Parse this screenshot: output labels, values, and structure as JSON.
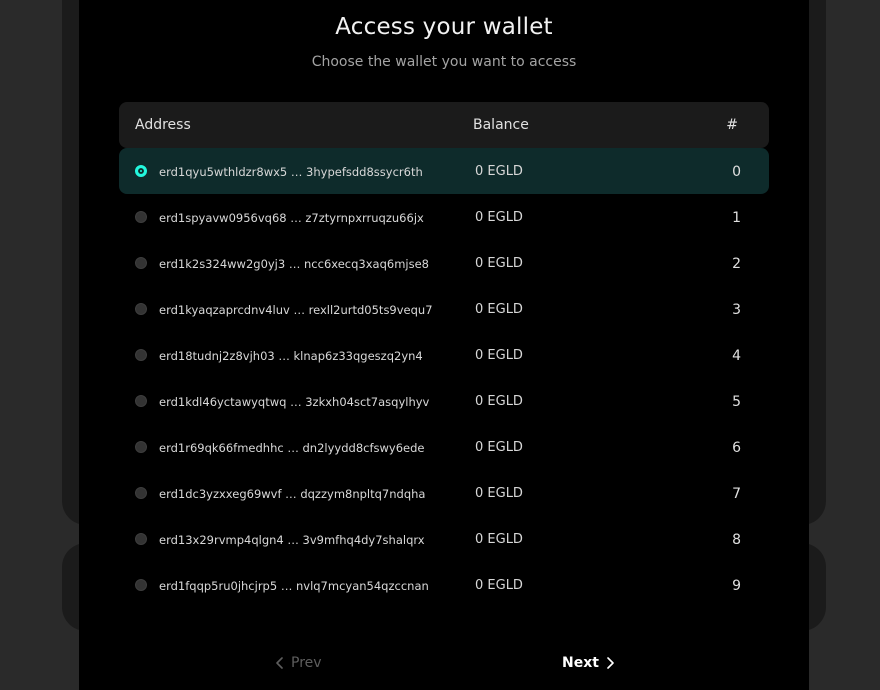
{
  "modal": {
    "title": "Access your wallet",
    "subtitle": "Choose the wallet you want to access"
  },
  "table": {
    "headers": {
      "address": "Address",
      "balance": "Balance",
      "index": "#"
    },
    "rows": [
      {
        "address": "erd1qyu5wthldzr8wx5 …  3hypefsdd8ssycr6th",
        "balance": "0 EGLD",
        "index": "0",
        "selected": true
      },
      {
        "address": "erd1spyavw0956vq68 …  z7ztyrnpxrruqzu66jx",
        "balance": "0 EGLD",
        "index": "1",
        "selected": false
      },
      {
        "address": "erd1k2s324ww2g0yj3 … ncc6xecq3xaq6mjse8",
        "balance": "0 EGLD",
        "index": "2",
        "selected": false
      },
      {
        "address": "erd1kyaqzaprcdnv4luv … rexll2urtd05ts9vequ7",
        "balance": "0 EGLD",
        "index": "3",
        "selected": false
      },
      {
        "address": "erd18tudnj2z8vjh03  …  klnap6z33qgeszq2yn4",
        "balance": "0 EGLD",
        "index": "4",
        "selected": false
      },
      {
        "address": "erd1kdl46yctawyqtwq … 3zkxh04sct7asqylhyv",
        "balance": "0 EGLD",
        "index": "5",
        "selected": false
      },
      {
        "address": "erd1r69qk66fmedhhc … dn2lyydd8cfswy6ede",
        "balance": "0 EGLD",
        "index": "6",
        "selected": false
      },
      {
        "address": "erd1dc3yzxxeg69wvf  … dqzzym8npltq7ndqha",
        "balance": "0 EGLD",
        "index": "7",
        "selected": false
      },
      {
        "address": "erd13x29rvmp4qlgn4  …  3v9mfhq4dy7shalqrx",
        "balance": "0 EGLD",
        "index": "8",
        "selected": false
      },
      {
        "address": "erd1fqqp5ru0jhcjrp5 … nvlq7mcyan54qzccnan",
        "balance": "0 EGLD",
        "index": "9",
        "selected": false
      }
    ]
  },
  "pagination": {
    "prev_label": "Prev",
    "next_label": "Next"
  },
  "colors": {
    "accent": "#23f7dd",
    "selected_row": "#0e2b2b"
  }
}
